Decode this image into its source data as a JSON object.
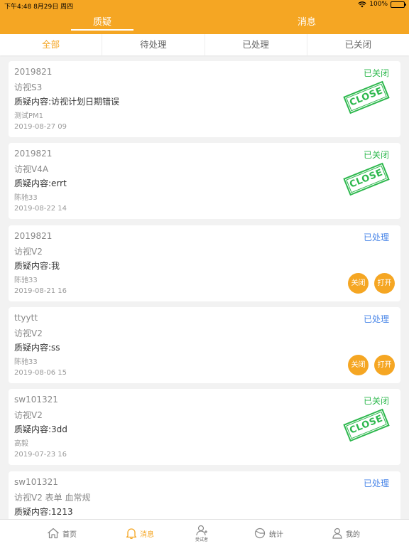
{
  "status_bar": {
    "time": "下午4:48  8月29日 周四",
    "battery_text": "100%"
  },
  "top_tabs": [
    {
      "label": "质疑",
      "active": true
    },
    {
      "label": "消息",
      "active": false
    }
  ],
  "sub_tabs": [
    {
      "label": "全部",
      "active": true
    },
    {
      "label": "待处理",
      "active": false
    },
    {
      "label": "已处理",
      "active": false
    },
    {
      "label": "已关闭",
      "active": false
    }
  ],
  "cards": [
    {
      "code": "2019821",
      "visit": "访视S3",
      "content": "质疑内容:访视计划日期错误",
      "author": "测试PM1",
      "date": "2019-08-27 09",
      "status": "已关闭",
      "stamp": "CLOSE"
    },
    {
      "code": "2019821",
      "visit": "访视V4A",
      "content": "质疑内容:errt",
      "author": "陈驰33",
      "date": "2019-08-22 14",
      "status": "已关闭",
      "stamp": "CLOSE"
    },
    {
      "code": "2019821",
      "visit": "访视V2",
      "content": "质疑内容:我",
      "author": "陈驰33",
      "date": "2019-08-21 16",
      "status": "已处理",
      "close_label": "关闭",
      "open_label": "打开"
    },
    {
      "code": "ttyytt",
      "visit": "访视V2",
      "content": "质疑内容:ss",
      "author": "陈驰33",
      "date": "2019-08-06 15",
      "status": "已处理",
      "close_label": "关闭",
      "open_label": "打开"
    },
    {
      "code": "sw101321",
      "visit": "访视V2",
      "content": "质疑内容:3dd",
      "author": "高毅",
      "date": "2019-07-23 16",
      "status": "已关闭",
      "stamp": "CLOSE"
    },
    {
      "code": "sw101321",
      "visit": "访视V2 表单 血常规",
      "content": "质疑内容:1213",
      "author": "",
      "date": "",
      "status": "已处理",
      "close_label": "关闭",
      "open_label": "打开"
    }
  ],
  "bottom_nav": [
    {
      "label": "首页",
      "icon": "home-icon",
      "active": false
    },
    {
      "label": "消息",
      "icon": "bell-icon",
      "active": true
    },
    {
      "label": "受试者",
      "icon": "add-person-icon",
      "active": false
    },
    {
      "label": "统计",
      "icon": "pie-chart-icon",
      "active": false
    },
    {
      "label": "我的",
      "icon": "user-icon",
      "active": false
    }
  ],
  "colors": {
    "accent": "#f5a623",
    "closed": "#2db84d",
    "processed": "#4a86e8"
  }
}
